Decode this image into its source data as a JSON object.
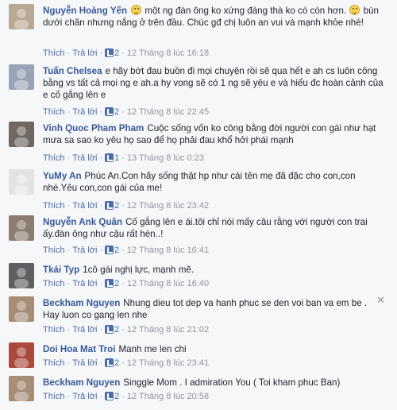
{
  "labels": {
    "like": "Thích",
    "reply": "Trả lời",
    "separator": "·"
  },
  "comments": [
    {
      "author": "Nguyễn Hoàng Yến",
      "text_a": "một ng đàn ông ko xứng đáng thà ko có còn hơn.",
      "text_b": "bùn dưới chân nhưng nắng ở trên đầu. Chúc gđ chị luôn an vui và mạnh khỏe nhé!",
      "likes": "2",
      "time": "12 Tháng 8 lúc 16:18",
      "avatar_color": "#b9a892"
    },
    {
      "author": "Tuấn Chelsea",
      "text": "e hãy bớt đau buồn đi mọi chuyện rồi sẽ qua hết e ah cs luôn công bằng vs tất cả mọi ng e ah.a hy vong sẽ có 1 ng sẽ yêu e và hiểu đc hoàn cảnh của e cố gắng lên e",
      "likes": "2",
      "time": "12 Tháng 8 lúc 22:45",
      "avatar_color": "#9aa3b5"
    },
    {
      "author": "Vinh Quoc Pham Pham",
      "text": "Cuộc sống vốn ko công bằng đời người con gái như hạt mưa sa sao ko yêu họ sao để họ phải đau khổ hởi phái mạnh",
      "likes": "1",
      "time": "13 Tháng 8 lúc 0:23",
      "avatar_color": "#6f6760"
    },
    {
      "author": "YuMy An",
      "text": "Phúc An.Con hãy sống thật hp như cái tên mẹ đã đặc cho con,con nhé.Yêu con,con gái của me!",
      "likes": "2",
      "time": "12 Tháng 8 lúc 23:42",
      "avatar_color": "#e3e3e3"
    },
    {
      "author": "Nguyễn Ank Quân",
      "text": "Cố gắng lên e ái.tôi chỉ nói mấy câu rằng với người con trai ấy.đàn ông như cậu rất hèn..!",
      "likes": "2",
      "time": "12 Tháng 8 lúc 16:41",
      "avatar_color": "#8a7c6e"
    },
    {
      "author": "Tkái Typ",
      "text": "1cô gái nghị lực, mạnh mẽ.",
      "likes": "2",
      "time": "12 Tháng 8 lúc 16:40",
      "avatar_color": "#5f5f63"
    },
    {
      "author": "Beckham Nguyen",
      "text": "Nhung dieu tot dep va hanh phuc se den voi ban va em be . Hay luon co gang len nhe",
      "likes": "2",
      "time": "12 Tháng 8 lúc 21:02",
      "avatar_color": "#a68d76"
    },
    {
      "author": "Doi Hoa Mat Troi",
      "text": "Manh me len chi",
      "likes": "2",
      "time": "12 Tháng 8 lúc 23:41",
      "avatar_color": "#a94b3c"
    },
    {
      "author": "Beckham Nguyen",
      "text": "Singgle Mom . I admiration You ( Toi kham phuc Ban)",
      "likes": "2",
      "time": "12 Tháng 8 lúc 20:58",
      "avatar_color": "#a68d76"
    }
  ],
  "icons": {
    "remove": "close-icon",
    "like_count": "thumbs-up-icon",
    "emoticon": "smile-emoticon-icon",
    "close_glyph": "✕"
  }
}
